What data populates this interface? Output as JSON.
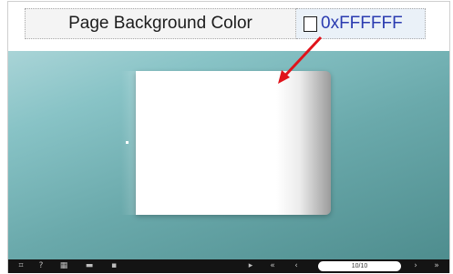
{
  "property": {
    "name": "Page Background Color",
    "value": "0xFFFFFF",
    "swatch_color": "#FFFFFF"
  },
  "stage": {
    "gradient_colors": [
      "#a9d4d7",
      "#88c3c6",
      "#6aa9ab",
      "#4e8d8e"
    ],
    "arrow_color": "#e0131b"
  },
  "toolbar": {
    "left_icons": [
      "fullscreen-icon",
      "help-icon",
      "thumbnails-icon",
      "print-icon",
      "download-icon"
    ],
    "right_icons": [
      "play-icon",
      "first-page-icon",
      "prev-page-icon",
      "next-page-icon",
      "last-page-icon"
    ],
    "page_indicator": "10/10"
  }
}
